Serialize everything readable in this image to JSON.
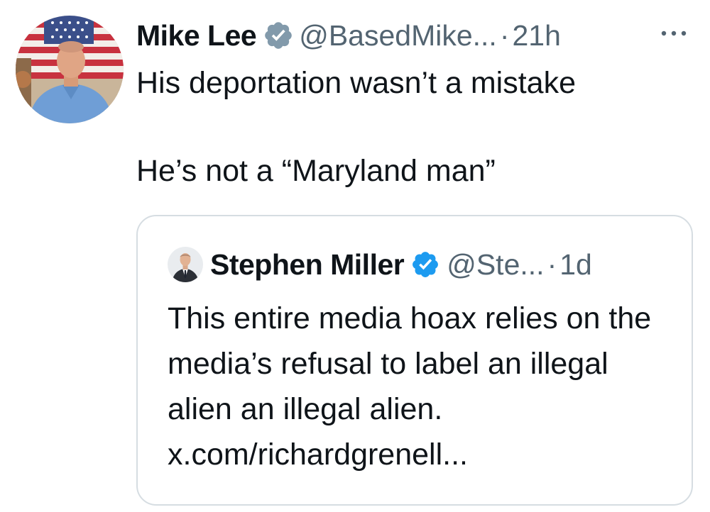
{
  "tweet": {
    "author_name": "Mike Lee",
    "handle": "@BasedMike...",
    "separator": "·",
    "time": "21h",
    "text_line1": "His deportation wasn’t a mistake",
    "text_line2": "He’s not a “Maryland man”",
    "avatar_icon": "profile-photo-flag-icon",
    "verified_icon": "verified-gray-badge-icon",
    "more_icon": "more-options-icon"
  },
  "quote": {
    "author_name": "Stephen Miller",
    "handle": "@Ste...",
    "separator": "·",
    "time": "1d",
    "text": "This entire media hoax relies on the media’s refusal to label an illegal alien an illegal alien. x.com/richardgrenell...",
    "avatar_icon": "profile-photo-suit-icon",
    "verified_icon": "verified-blue-badge-icon"
  },
  "colors": {
    "text": "#0f1419",
    "secondary": "#536471",
    "verified_blue": "#1d9bf0",
    "verified_gray": "#829aab",
    "border": "#d6dde2"
  }
}
